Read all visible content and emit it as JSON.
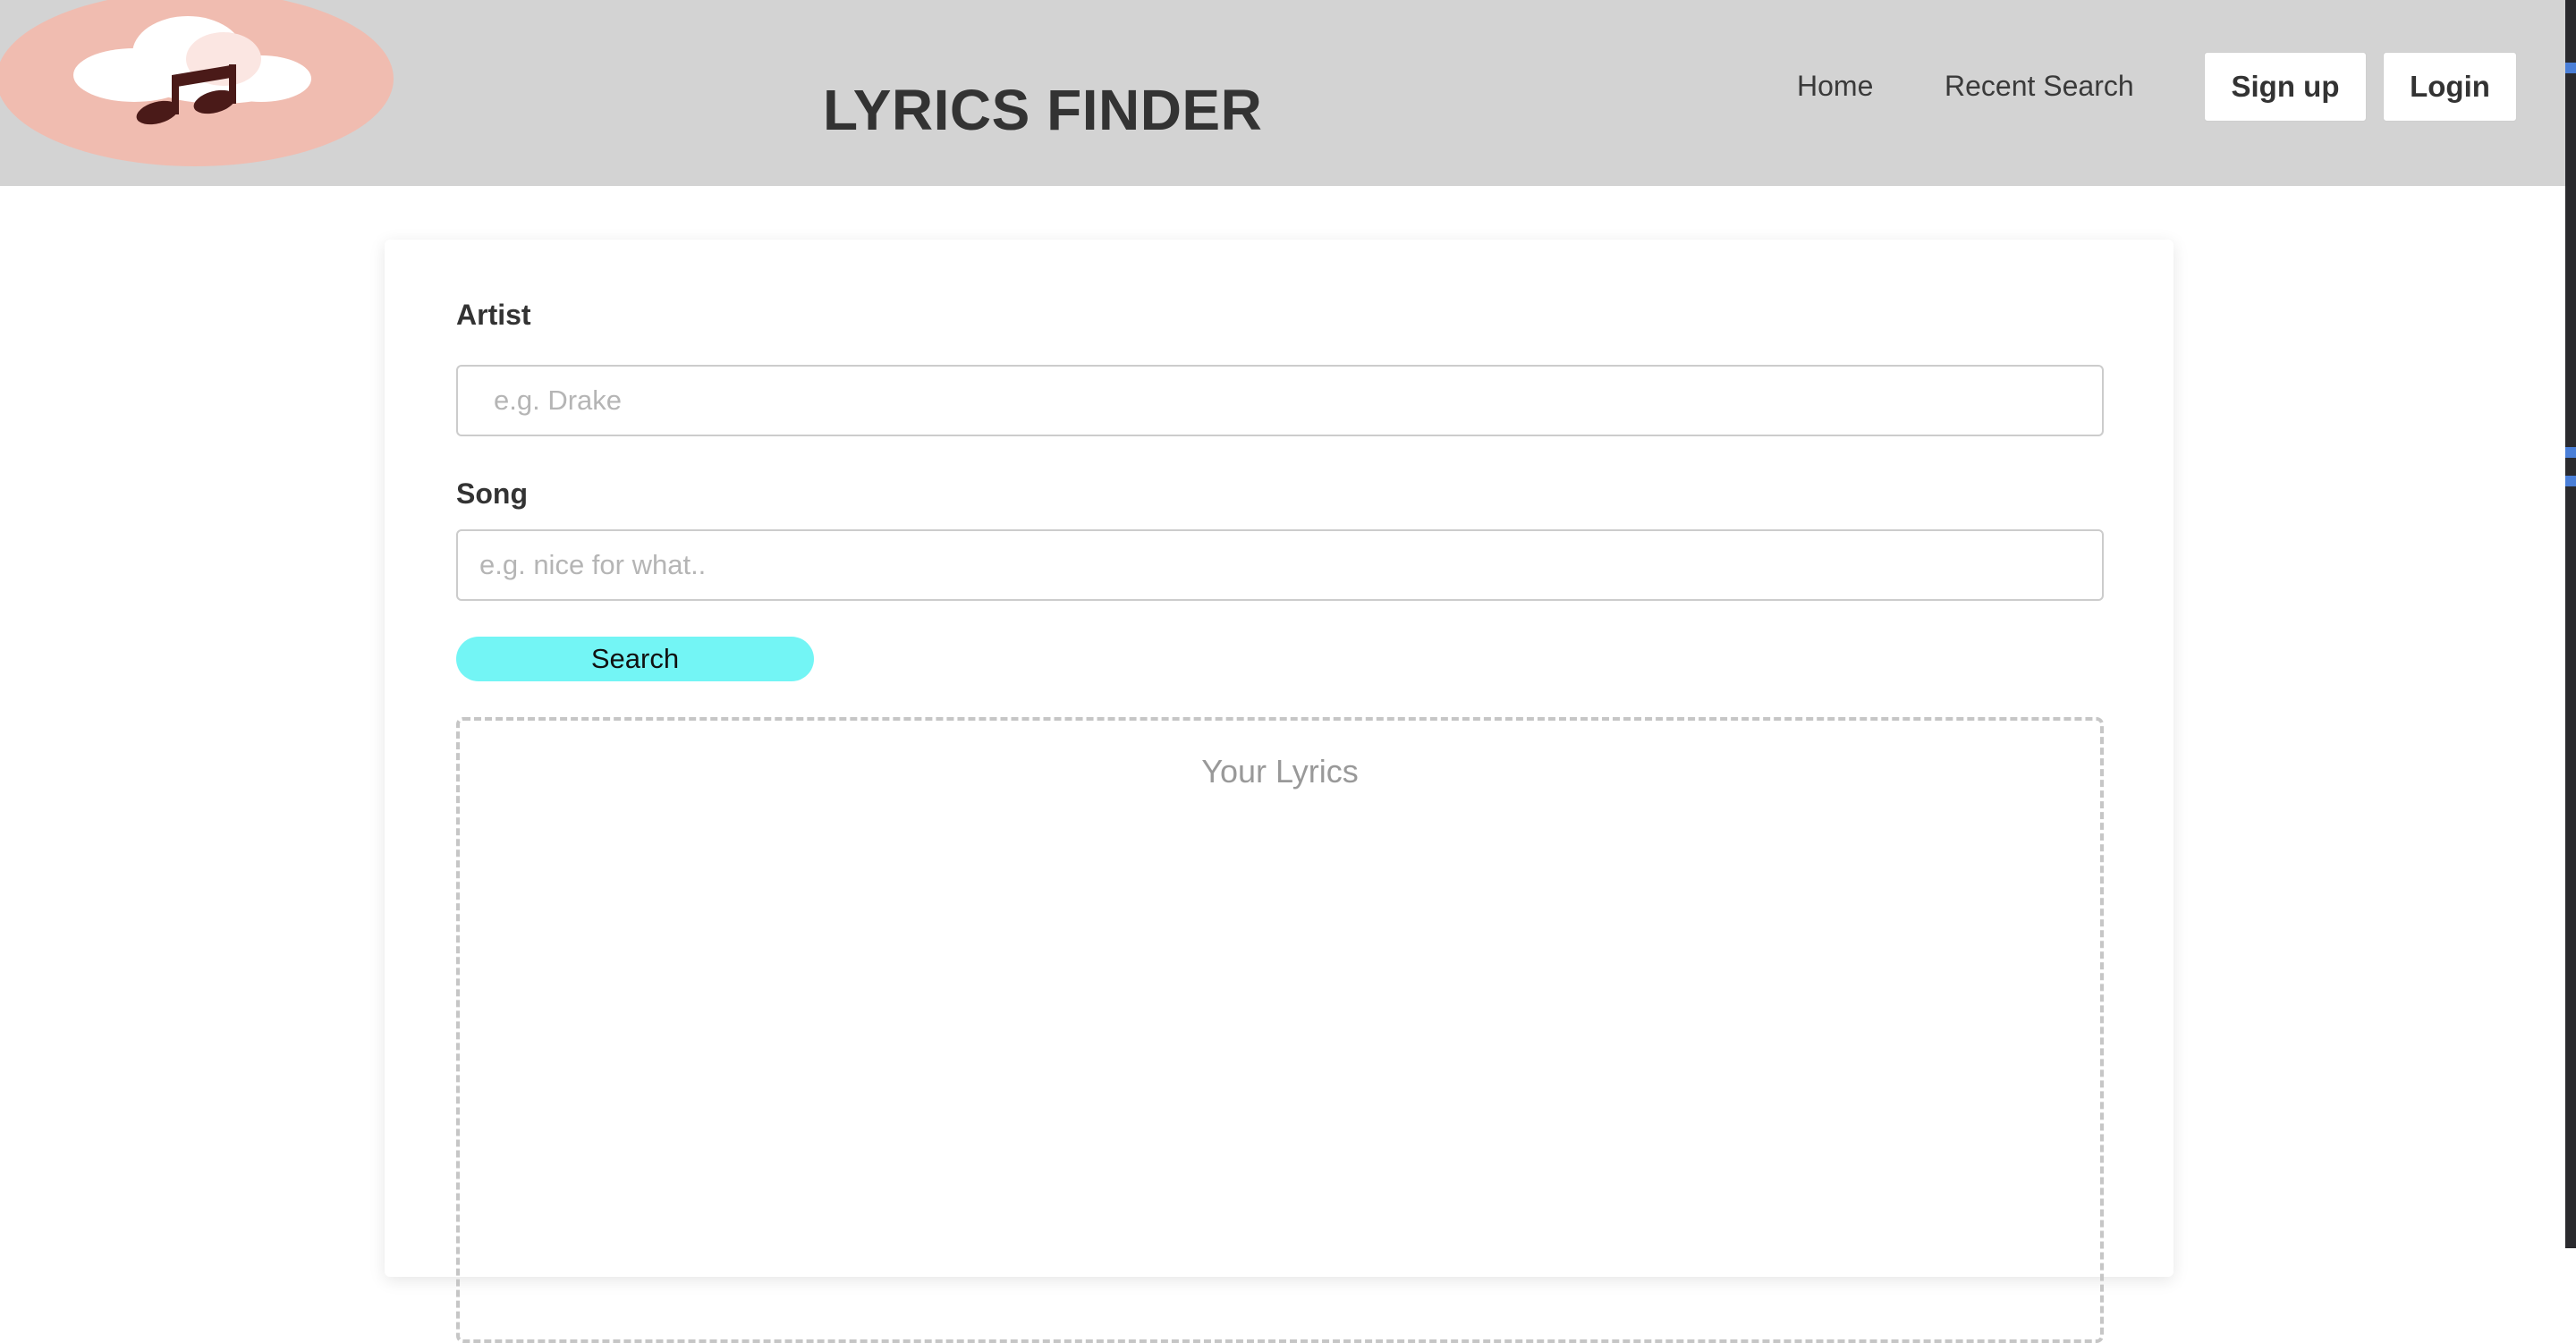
{
  "header": {
    "title": "LYRICS FINDER",
    "logo_icon": "music-cloud-icon",
    "nav": [
      {
        "label": "Home"
      },
      {
        "label": "Recent Search"
      }
    ],
    "signup_label": "Sign up",
    "login_label": "Login"
  },
  "form": {
    "artist": {
      "label": "Artist",
      "placeholder": "e.g. Drake",
      "value": ""
    },
    "song": {
      "label": "Song",
      "placeholder": "e.g. nice for what..",
      "value": ""
    },
    "search_label": "Search"
  },
  "lyrics": {
    "placeholder": "Your Lyrics"
  },
  "colors": {
    "header_bg": "#d3d3d3",
    "logo_bg": "#f0bcb0",
    "search_button": "#73f5f5"
  }
}
